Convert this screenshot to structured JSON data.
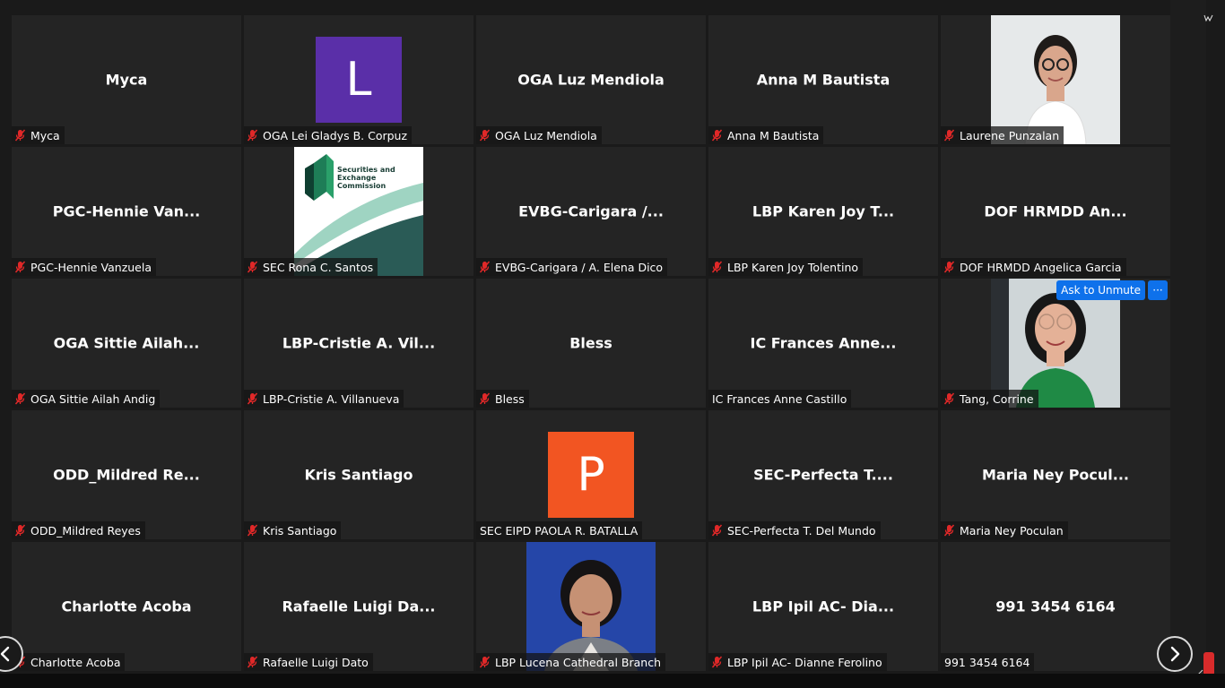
{
  "participants": [
    {
      "display": "Myca",
      "label": "Myca",
      "muted": true,
      "kind": "name"
    },
    {
      "display": "L",
      "label": "OGA Lei Gladys B. Corpuz",
      "muted": true,
      "kind": "avatar",
      "avatar_color": "#5a2fa8"
    },
    {
      "display": "OGA Luz Mendiola",
      "label": "OGA Luz Mendiola",
      "muted": true,
      "kind": "name"
    },
    {
      "display": "Anna M Bautista",
      "label": "Anna M Bautista",
      "muted": true,
      "kind": "name"
    },
    {
      "display": "",
      "label": "Laurene Punzalan",
      "muted": true,
      "kind": "photo",
      "photo": "woman-glasses-white"
    },
    {
      "display": "PGC-Hennie Van...",
      "label": "PGC-Hennie Vanzuela",
      "muted": true,
      "kind": "name"
    },
    {
      "display": "",
      "label": "SEC Rona C. Santos",
      "muted": true,
      "kind": "logo",
      "logo_text": "Securities and Exchange Commission"
    },
    {
      "display": "EVBG-Carigara /...",
      "label": "EVBG-Carigara / A. Elena  Dico",
      "muted": true,
      "kind": "name"
    },
    {
      "display": "LBP Karen Joy T...",
      "label": "LBP Karen Joy Tolentino",
      "muted": true,
      "kind": "name"
    },
    {
      "display": "DOF HRMDD An...",
      "label": "DOF HRMDD Angelica Garcia",
      "muted": true,
      "kind": "name"
    },
    {
      "display": "OGA Sittie Ailah...",
      "label": "OGA Sittie Ailah Andig",
      "muted": true,
      "kind": "name"
    },
    {
      "display": "LBP-Cristie A. Vil...",
      "label": "LBP-Cristie A. Villanueva",
      "muted": true,
      "kind": "name"
    },
    {
      "display": "Bless",
      "label": "Bless",
      "muted": true,
      "kind": "name"
    },
    {
      "display": "IC Frances Anne...",
      "label": "IC Frances Anne Castillo",
      "muted": false,
      "kind": "name"
    },
    {
      "display": "",
      "label": "Tang, Corrine",
      "muted": true,
      "kind": "photo",
      "photo": "woman-glasses-green",
      "ask_to_unmute": "Ask to Unmute",
      "more": "···"
    },
    {
      "display": "ODD_Mildred  Re...",
      "label": "ODD_Mildred Reyes",
      "muted": true,
      "kind": "name"
    },
    {
      "display": "Kris Santiago",
      "label": "Kris Santiago",
      "muted": true,
      "kind": "name"
    },
    {
      "display": "P",
      "label": "SEC EIPD PAOLA R. BATALLA",
      "muted": false,
      "kind": "avatar",
      "avatar_color": "#f25522"
    },
    {
      "display": "SEC-Perfecta T....",
      "label": "SEC-Perfecta T. Del Mundo",
      "muted": true,
      "kind": "name"
    },
    {
      "display": "Maria Ney Pocul...",
      "label": "Maria Ney Poculan",
      "muted": true,
      "kind": "name"
    },
    {
      "display": "Charlotte Acoba",
      "label": "Charlotte Acoba",
      "muted": true,
      "kind": "name"
    },
    {
      "display": "Rafaelle Luigi Da...",
      "label": "Rafaelle Luigi Dato",
      "muted": true,
      "kind": "name"
    },
    {
      "display": "",
      "label": "LBP Lucena Cathedral Branch",
      "muted": true,
      "kind": "photo",
      "photo": "woman-blue-bg"
    },
    {
      "display": "LBP Ipil AC- Dia...",
      "label": "LBP Ipil AC- Dianne Ferolino",
      "muted": true,
      "kind": "name"
    },
    {
      "display": "991 3454 6164",
      "label": "991 3454 6164",
      "muted": false,
      "kind": "name"
    }
  ],
  "icons": {
    "mute": "mic-muted-icon",
    "prev": "chevron-left-icon",
    "next": "chevron-right-icon"
  },
  "colors": {
    "tile_bg": "#242424",
    "mute_red": "#e02828",
    "unmute_blue": "#0e71eb"
  }
}
